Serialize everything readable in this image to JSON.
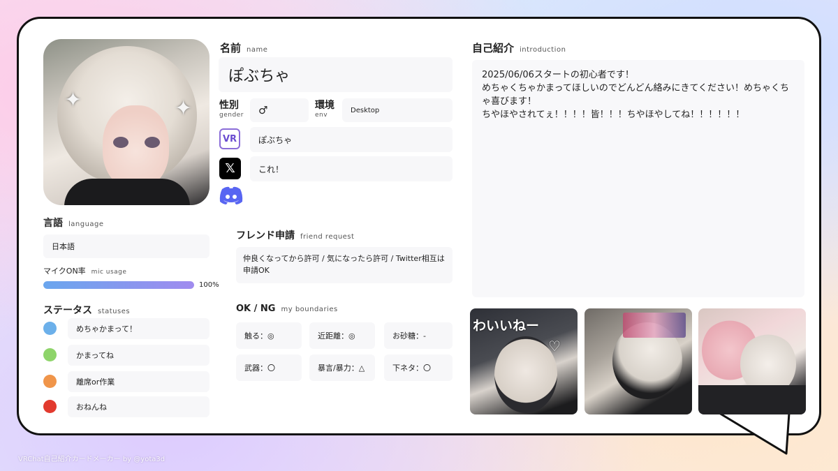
{
  "name_section": {
    "title": "名前",
    "sub": "name",
    "value": "ぽぶちゃ"
  },
  "gender": {
    "title": "性別",
    "sub": "gender",
    "value": "♂"
  },
  "env": {
    "title": "環境",
    "sub": "env",
    "value": "Desktop"
  },
  "social": {
    "vrchat": {
      "icon": "vrchat-icon",
      "icon_text": "VR",
      "value": "ぽぶちゃ"
    },
    "x": {
      "icon": "x-icon",
      "icon_text": "𝕏",
      "value": "これ！"
    },
    "discord": {
      "icon": "discord-icon",
      "value": ""
    }
  },
  "language": {
    "title": "言語",
    "sub": "language",
    "value": "日本語"
  },
  "mic": {
    "title": "マイクON率",
    "sub": "mic usage",
    "percent": 100,
    "percent_text": "100%"
  },
  "statuses": {
    "title": "ステータス",
    "sub": "statuses",
    "items": [
      {
        "color": "#6cb0ea",
        "label": "めちゃかまって！"
      },
      {
        "color": "#8ed46a",
        "label": "かまってね"
      },
      {
        "color": "#f0954a",
        "label": "離席or作業"
      },
      {
        "color": "#e23a2e",
        "label": "おねんね"
      }
    ]
  },
  "friend": {
    "title": "フレンド申請",
    "sub": "friend request",
    "text": "仲良くなってから許可 / 気になったら許可 / Twitter相互は申請OK"
  },
  "boundaries": {
    "title": "OK / NG",
    "sub": "my boundaries",
    "items": [
      {
        "label": "触る：◎"
      },
      {
        "label": "近距離：◎"
      },
      {
        "label": "お砂糖：-"
      },
      {
        "label": "武器：〇"
      },
      {
        "label": "暴言/暴力：△"
      },
      {
        "label": "下ネタ：〇"
      }
    ]
  },
  "intro": {
    "title": "自己紹介",
    "sub": "introduction",
    "text": "2025/06/06スタートの初心者です！\nめちゃくちゃかまってほしいのでどんどん絡みにきてください！めちゃくちゃ喜びます！\nちやほやされてぇ！！！！皆！！！ちやほやしてね！！！！！！"
  },
  "gallery": {
    "thumb1_text": "わいいねー",
    "thumb1_heart": "♡"
  },
  "footer": "VRChat自己紹介カードメーカー by @yota3d"
}
